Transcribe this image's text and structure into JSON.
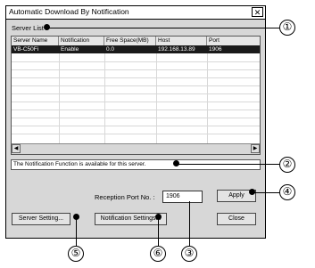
{
  "window": {
    "title": "Automatic Download By Notification",
    "close_glyph": "✕"
  },
  "server_list": {
    "label": "Server List :",
    "columns": [
      "Server Name",
      "Notification",
      "Free Space(MB)",
      "Host",
      "Port"
    ],
    "rows": [
      {
        "server_name": "VB-C50Fi",
        "notification": "Enable",
        "free_space": "0.0",
        "host": "192.168.13.89",
        "port": "1906"
      }
    ],
    "scroll_left_glyph": "◀",
    "scroll_right_glyph": "▶"
  },
  "status_message": "The Notification Function is available for this server.",
  "reception_port": {
    "label": "Reception Port No. :",
    "value": "1906"
  },
  "buttons": {
    "apply": "Apply",
    "server_setting": "Server Setting...",
    "notification_settings": "Notification Settings...",
    "close": "Close"
  },
  "callouts": [
    "①",
    "②",
    "③",
    "④",
    "⑤",
    "⑥"
  ]
}
